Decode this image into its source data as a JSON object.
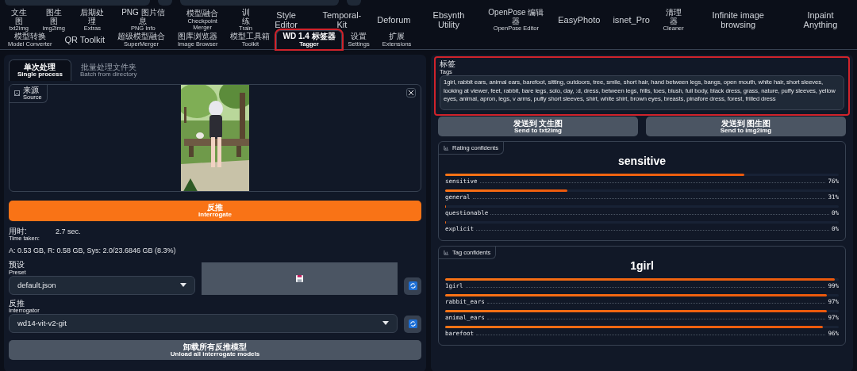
{
  "main_tabs": [
    {
      "label": "文生图",
      "sub": "txt2img",
      "selected": false,
      "highlighted": false
    },
    {
      "label": "图生图",
      "sub": "img2img",
      "selected": false,
      "highlighted": false
    },
    {
      "label": "后期处理",
      "sub": "Extras",
      "selected": false,
      "highlighted": false
    },
    {
      "label": "PNG 图片信息",
      "sub": "PNG Info",
      "selected": false,
      "highlighted": false
    },
    {
      "label": "模型融合",
      "sub": "Checkpoint Merger",
      "selected": false,
      "highlighted": false
    },
    {
      "label": "训练",
      "sub": "Train",
      "selected": false,
      "highlighted": false
    },
    {
      "label": "Style Editor",
      "selected": false,
      "highlighted": false
    },
    {
      "label": "Temporal-Kit",
      "selected": false,
      "highlighted": false
    },
    {
      "label": "Deforum",
      "selected": false,
      "highlighted": false
    },
    {
      "label": "Ebsynth Utility",
      "selected": false,
      "highlighted": false
    },
    {
      "label": "OpenPose 编辑器",
      "sub": "OpenPose Editor",
      "selected": false,
      "highlighted": false
    },
    {
      "label": "EasyPhoto",
      "selected": false,
      "highlighted": false
    },
    {
      "label": "isnet_Pro",
      "selected": false,
      "highlighted": false
    },
    {
      "label": "清理器",
      "sub": "Cleaner",
      "selected": false,
      "highlighted": false
    },
    {
      "label": "Infinite image browsing",
      "selected": false,
      "highlighted": false
    },
    {
      "label": "Inpaint Anything",
      "selected": false,
      "highlighted": false
    },
    {
      "label": "模型转换",
      "sub": "Model Converter",
      "selected": false,
      "highlighted": false
    },
    {
      "label": "QR Toolkit",
      "selected": false,
      "highlighted": false
    },
    {
      "label": "超级模型融合",
      "sub": "SuperMerger",
      "selected": false,
      "highlighted": false
    },
    {
      "label": "图库浏览器",
      "sub": "Image Browser",
      "selected": false,
      "highlighted": false
    },
    {
      "label": "模型工具箱",
      "sub": "Toolkit",
      "selected": false,
      "highlighted": false
    },
    {
      "label": "WD 1.4 标签器",
      "sub": "Tagger",
      "selected": true,
      "highlighted": true
    },
    {
      "label": "设置",
      "sub": "Settings",
      "selected": false,
      "highlighted": false
    },
    {
      "label": "扩展",
      "sub": "Extensions",
      "selected": false,
      "highlighted": false
    }
  ],
  "sub_tabs": [
    {
      "label": "单次处理",
      "sub": "Single process",
      "selected": true
    },
    {
      "label": "批量处理文件夹",
      "sub": "Batch from directory",
      "selected": false
    }
  ],
  "source": {
    "label": "来源",
    "sub": "Source"
  },
  "interrogate_button": {
    "label": "反推",
    "sub": "Interrogate"
  },
  "time_taken": {
    "label": "用时:",
    "sub": "Time taken:",
    "value": "2.7 sec."
  },
  "memory": "A: 0.53 GB, R: 0.58 GB, Sys: 2.0/23.6846 GB (8.3%)",
  "preset": {
    "label": "预设",
    "sub": "Preset",
    "value": "default.json"
  },
  "interrogator": {
    "label": "反推",
    "sub": "Interrogator",
    "value": "wd14-vit-v2-git"
  },
  "unload_button": {
    "label": "卸载所有反推模型",
    "sub": "Unload all interrogate models"
  },
  "tags": {
    "label": "标签",
    "sub": "Tags",
    "highlighted": true,
    "value": "1girl, rabbit ears, animal ears, barefoot, sitting, outdoors, tree, smile, short hair, hand between legs, bangs, open mouth, white hair, short sleeves, looking at viewer, feet, rabbit, bare legs, solo, day, :d, dress, between legs, frills, toes, blush, full body, black dress, grass, nature, puffy sleeves, yellow eyes, animal, apron, legs, v arms, puffy short sleeves, shirt, white shirt, brown eyes, breasts, pinafore dress, forest, frilled dress"
  },
  "send_buttons": [
    {
      "label": "发送到 文生图",
      "sub": "Send to txt2img"
    },
    {
      "label": "发送到 图生图",
      "sub": "Send to img2img"
    }
  ],
  "panels": [
    {
      "title": "Rating confidents",
      "top": "sensitive",
      "rows": [
        {
          "name": "sensitive",
          "value": "76%",
          "level": 0.76
        },
        {
          "name": "general",
          "value": "31%",
          "level": 0.31
        },
        {
          "name": "questionable",
          "value": "0%",
          "level": 0.0
        },
        {
          "name": "explicit",
          "value": "0%",
          "level": 0.0
        }
      ]
    },
    {
      "title": "Tag confidents",
      "top": "1girl",
      "rows": [
        {
          "name": "1girl",
          "value": "99%",
          "level": 0.99
        },
        {
          "name": "rabbit_ears",
          "value": "97%",
          "level": 0.97
        },
        {
          "name": "animal_ears",
          "value": "97%",
          "level": 0.97
        },
        {
          "name": "barefoot",
          "value": "96%",
          "level": 0.96
        }
      ]
    }
  ]
}
